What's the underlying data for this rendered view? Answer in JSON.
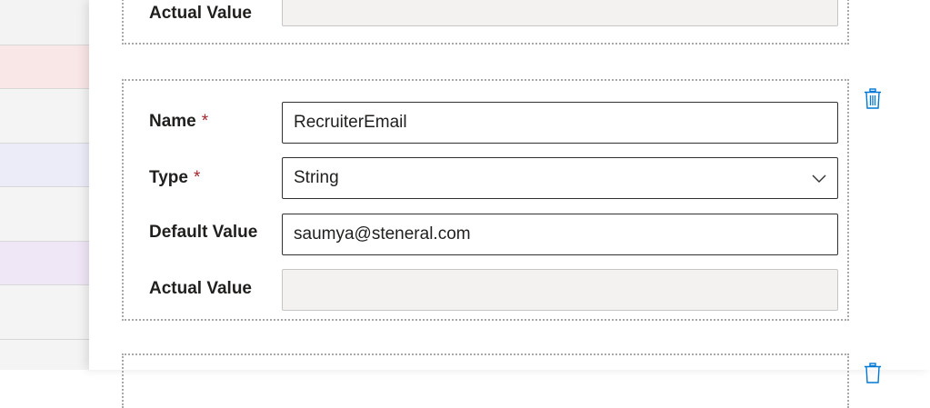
{
  "colors": {
    "required_marker": "#a4262c",
    "icon_accent": "#0078d4",
    "readonly_bg": "#f3f2f1"
  },
  "top_card": {
    "actual_value_label": "Actual Value",
    "actual_value": ""
  },
  "param_card": {
    "name_label": "Name",
    "name_required": "*",
    "name_value": "RecruiterEmail",
    "type_label": "Type",
    "type_required": "*",
    "type_value": "String",
    "default_label": "Default Value",
    "default_value": "saumya@steneral.com",
    "actual_label": "Actual Value",
    "actual_value": "",
    "delete_icon": "trash-icon",
    "dropdown_icon": "chevron-down-icon"
  }
}
